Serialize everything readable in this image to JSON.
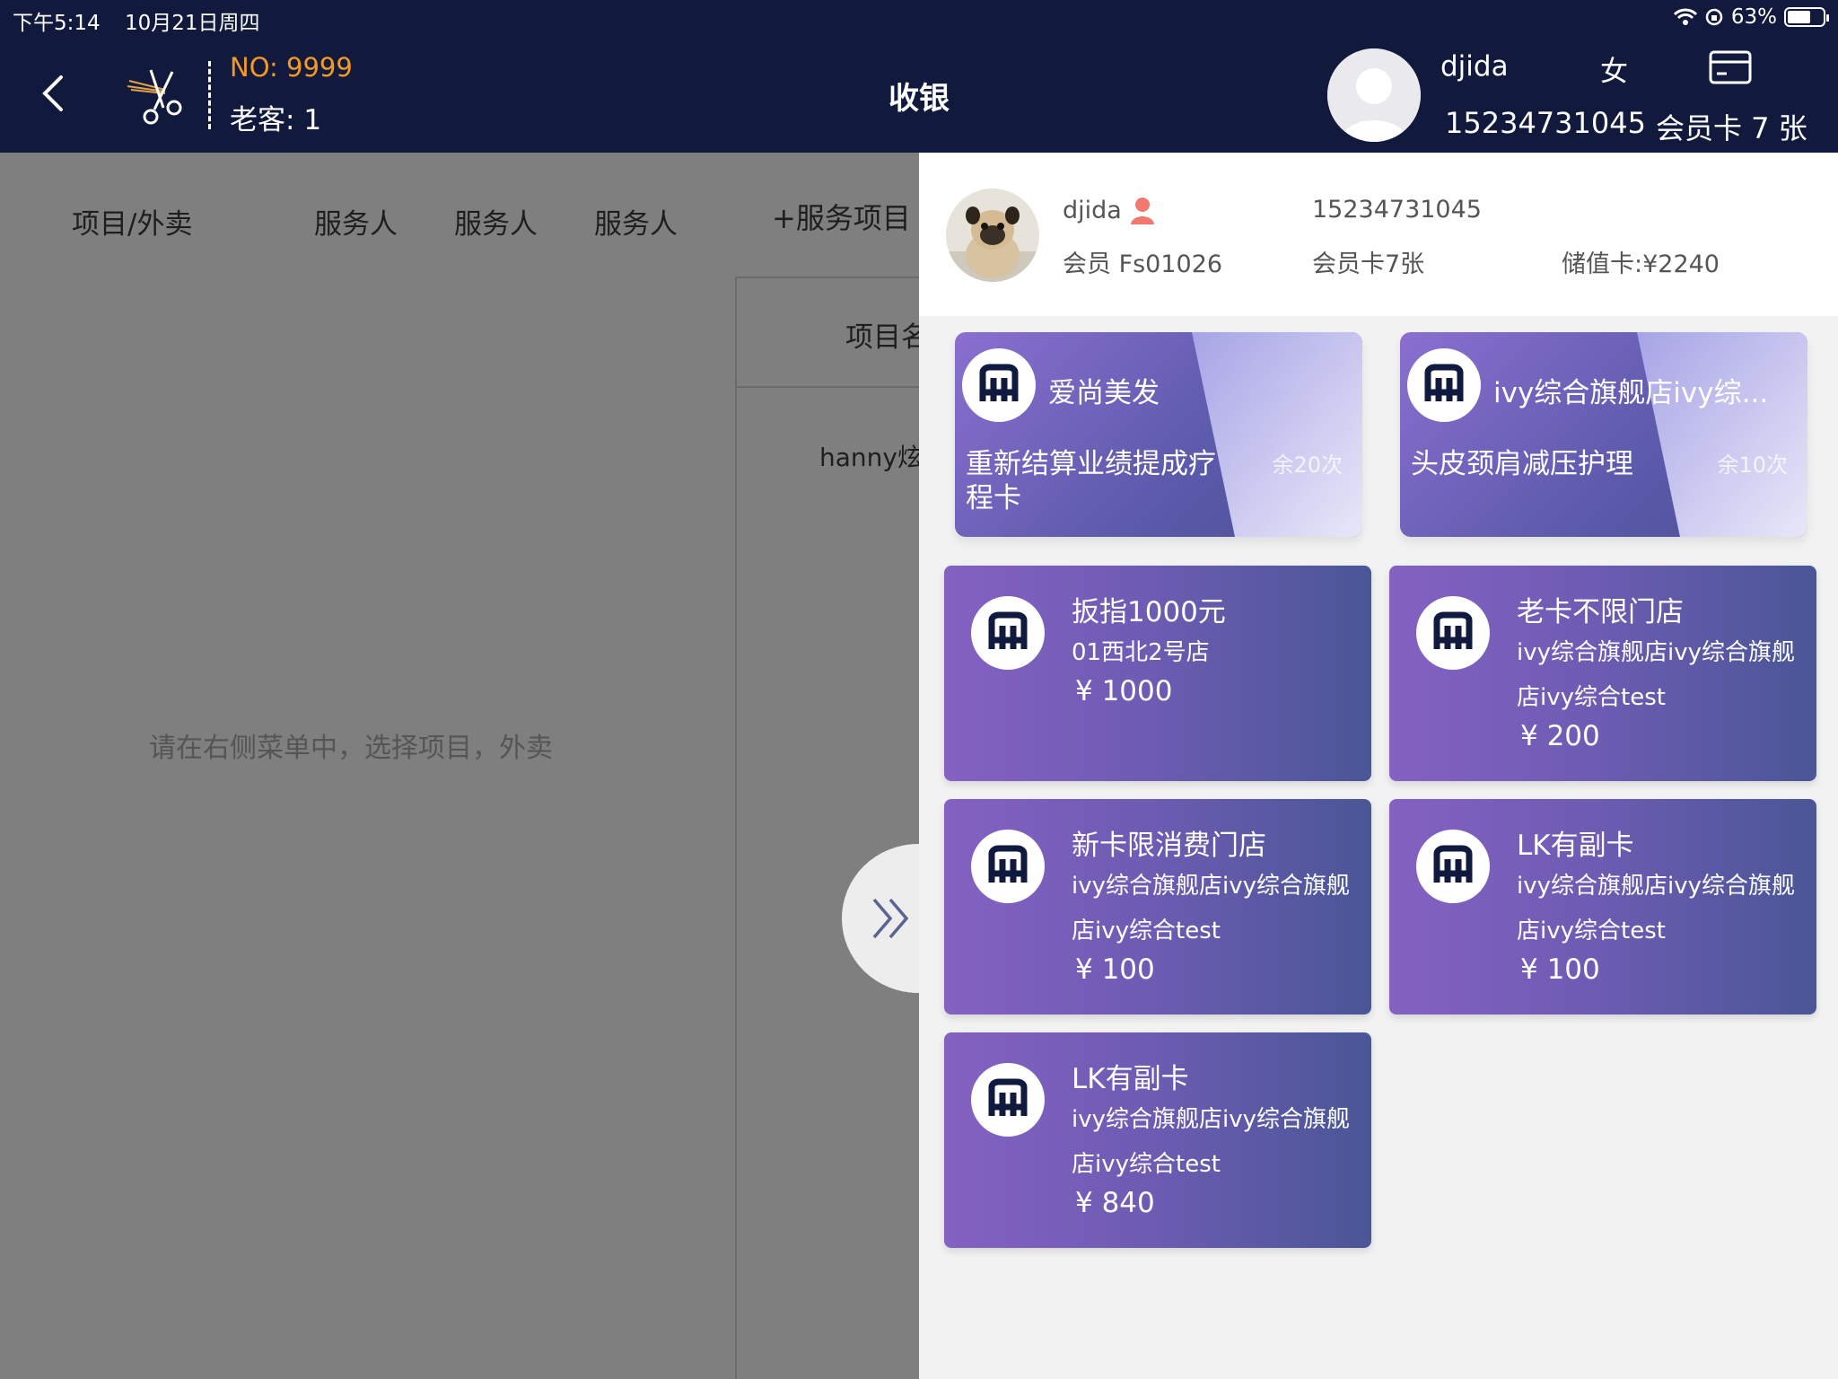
{
  "status_bar": {
    "time": "下午5:14",
    "date": "10月21日周四",
    "battery": "63%"
  },
  "header": {
    "ticket_no_label": "NO:",
    "ticket_no": "9999",
    "old_guest_label": "老客:",
    "old_guest_count": "1",
    "title": "收银",
    "customer_name": "djida",
    "customer_gender": "女",
    "customer_phone": "15234731045",
    "member_cards": "会员卡 7 张"
  },
  "left": {
    "columns": [
      "项目/外卖",
      "服务人",
      "服务人",
      "服务人"
    ],
    "add_service": "+服务项目",
    "table_header": "项目名",
    "table_cell": "hanny炫",
    "hint": "请在右侧菜单中，选择项目，外卖"
  },
  "panel": {
    "member": {
      "name": "djida",
      "level": "会员 Fs01026",
      "phone": "15234731045",
      "cards": "会员卡7张",
      "stored_value": "储值卡:¥2240"
    },
    "course_cards": [
      {
        "store": "爱尚美发",
        "item": "重新结算业绩提成疗程卡",
        "remaining": "余20次"
      },
      {
        "store": "ivy综合旗舰店ivy综...",
        "item": "头皮颈肩减压护理",
        "remaining": "余10次"
      }
    ],
    "value_cards": [
      {
        "title": "扳指1000元",
        "desc": "01西北2号店",
        "price": "¥ 1000"
      },
      {
        "title": "老卡不限门店",
        "desc": "ivy综合旗舰店ivy综合旗舰店ivy综合test",
        "price": "¥ 200"
      },
      {
        "title": "新卡限消费门店",
        "desc": "ivy综合旗舰店ivy综合旗舰店ivy综合test",
        "price": "¥ 100"
      },
      {
        "title": "LK有副卡",
        "desc": "ivy综合旗舰店ivy综合旗舰店ivy综合test",
        "price": "¥ 100"
      },
      {
        "title": "LK有副卡",
        "desc": "ivy综合旗舰店ivy综合旗舰店ivy综合test",
        "price": "¥ 840"
      }
    ]
  },
  "icons": [
    "back-icon",
    "scissors-icon",
    "card-icon",
    "avatar-placeholder-icon",
    "female-icon",
    "store-logo-icon",
    "double-chevron-right-icon"
  ],
  "colors": {
    "header_bg": "#111a3d",
    "ticket_accent": "#f39a22",
    "card_purple": "#8461c2",
    "card_blue": "#4a5696"
  }
}
